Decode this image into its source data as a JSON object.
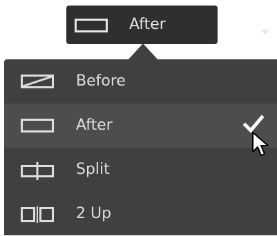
{
  "toggle": {
    "label": "After",
    "icon": "after-rect-icon"
  },
  "menu": {
    "items": [
      {
        "label": "Before",
        "icon": "before-diagonal-icon",
        "selected": false
      },
      {
        "label": "After",
        "icon": "after-rect-icon",
        "selected": true
      },
      {
        "label": "Split",
        "icon": "split-view-icon",
        "selected": false
      },
      {
        "label": "2 Up",
        "icon": "two-up-icon",
        "selected": false
      }
    ]
  },
  "colors": {
    "button_bg": "#2f2f2f",
    "menu_bg": "#404040",
    "selected_bg": "#4d4d4d",
    "text": "#dedede"
  }
}
